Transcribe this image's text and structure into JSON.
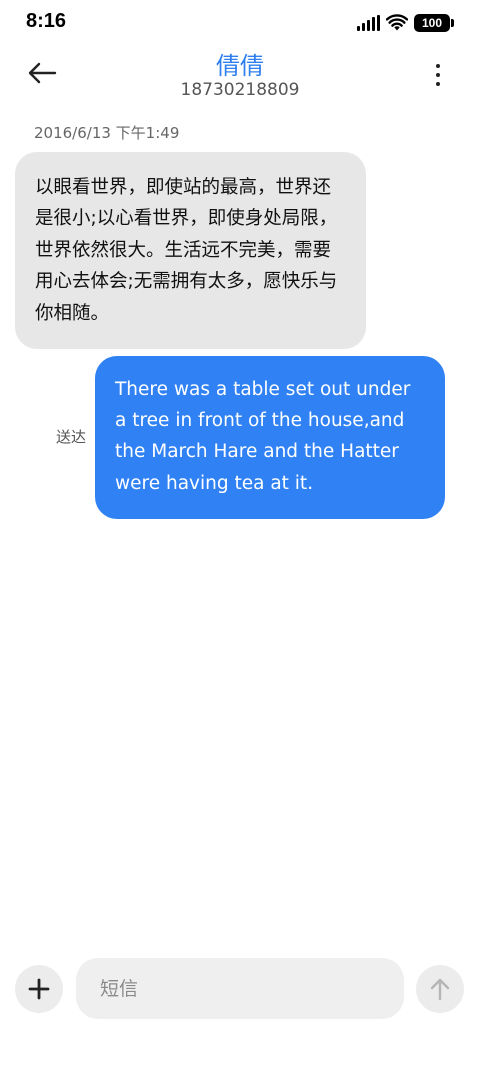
{
  "status_bar": {
    "time": "8:16",
    "battery": "100",
    "icons": [
      "signal-icon",
      "wifi-icon",
      "battery-icon"
    ]
  },
  "header": {
    "contact_name": "倩倩",
    "contact_number": "18730218809",
    "back_icon": "arrow-left-icon",
    "more_icon": "more-vertical-icon"
  },
  "conversation": {
    "timestamp": "2016/6/13 下午1:49",
    "messages": [
      {
        "direction": "incoming",
        "text": "以眼看世界，即使站的最高，世界还是很小;以心看世界，即使身处局限，世界依然很大。生活远不完美，需要用心去体会;无需拥有太多，愿快乐与你相随。"
      },
      {
        "direction": "outgoing",
        "text": "There was a table set out under a tree in front of the house,and the March Hare and the Hatter were having tea at it.",
        "status": "送达"
      }
    ]
  },
  "composer": {
    "placeholder": "短信",
    "value": "",
    "add_icon": "plus-icon",
    "send_icon": "arrow-up-icon"
  },
  "colors": {
    "accent": "#2f7ff0",
    "outgoing_bubble": "#3082f4",
    "incoming_bubble": "#e7e7e7",
    "button_bg": "#ececec"
  }
}
